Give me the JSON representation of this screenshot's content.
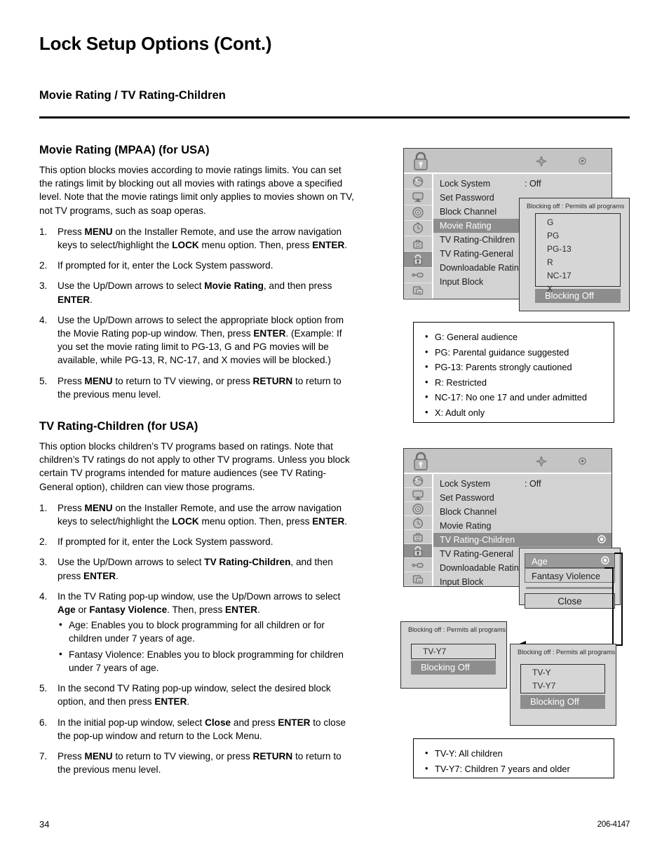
{
  "document": {
    "page_title": "Lock Setup Options (Cont.)",
    "section_title": "Movie Rating / TV Rating-Children",
    "page_number": "34",
    "doc_number": "206-4147"
  },
  "movie_rating": {
    "heading": "Movie Rating (MPAA) (for USA)",
    "intro": "This option blocks movies according to movie ratings limits. You can set the ratings limit by blocking out all movies with ratings above a specified level. Note that the movie ratings limit only applies to movies shown on TV, not TV programs, such as soap operas.",
    "steps": [
      {
        "num": "1.",
        "html": "Press <b>MENU</b> on the Installer Remote, and use the arrow navigation keys to select/highlight the <b>LOCK</b> menu option. Then, press <b>ENTER</b>."
      },
      {
        "num": "2.",
        "html": "If prompted for it, enter the Lock System password."
      },
      {
        "num": "3.",
        "html": "Use the Up/Down arrows to select <b>Movie Rating</b>, and then press <b>ENTER</b>."
      },
      {
        "num": "4.",
        "html": "Use the Up/Down arrows to select the appropriate block option from the Movie Rating pop-up window. Then, press <b>ENTER</b>. (Example: If you set the movie rating limit to PG-13, G and PG movies will be available, while PG-13, R, NC-17, and X movies will be blocked.)"
      },
      {
        "num": "5.",
        "html": "Press <b>MENU</b> to return to TV viewing, or press <b>RETURN</b> to return to the previous menu level."
      }
    ]
  },
  "tv_rating_children": {
    "heading": "TV Rating-Children (for USA)",
    "intro": "This option blocks children’s TV programs based on ratings. Note that children’s TV ratings do not apply to other TV programs. Unless you block certain TV programs intended for mature audiences (see TV Rating-General option), children can view those programs.",
    "steps": [
      {
        "num": "1.",
        "html": "Press <b>MENU</b> on the Installer Remote, and use the arrow navigation keys to select/highlight the <b>LOCK</b> menu option. Then, press <b>ENTER</b>."
      },
      {
        "num": "2.",
        "html": "If prompted for it, enter the Lock System password."
      },
      {
        "num": "3.",
        "html": "Use the Up/Down arrows to select <b>TV Rating-Children</b>, and then press <b>ENTER</b>."
      },
      {
        "num": "4.",
        "html": "In the TV Rating pop-up window, use the Up/Down arrows to select <b>Age</b> or <b>Fantasy Violence</b>. Then, press <b>ENTER</b>.",
        "bullets": [
          "Age: Enables you to block programming for all children or for children under 7 years of age.",
          "Fantasy Violence: Enables you to block programming for children under 7 years of age."
        ]
      },
      {
        "num": "5.",
        "html": "In the second TV Rating pop-up window, select the desired block option, and then press <b>ENTER</b>."
      },
      {
        "num": "6.",
        "html": "In the initial pop-up window, select <b>Close</b> and press <b>ENTER</b> to close the pop-up window and return to the Lock Menu."
      },
      {
        "num": "7.",
        "html": "Press <b>MENU</b> to return to TV viewing, or press <b>RETURN</b> to return to the previous menu level."
      }
    ]
  },
  "osd_menu_1": {
    "rail_icons": [
      "picture-icon",
      "screen-icon",
      "gear-icon",
      "clock-icon",
      "briefcase-icon",
      "lock-icon",
      "plug-icon",
      "setup-icon"
    ],
    "selected_rail_index": 5,
    "header_icons": [
      "lock-icon",
      "navigation-pad-icon",
      "enter-ok-icon"
    ],
    "items": [
      {
        "label": "Lock System",
        "value": ": Off",
        "highlighted": false
      },
      {
        "label": "Set Password",
        "value": "",
        "highlighted": false
      },
      {
        "label": "Block Channel",
        "value": "",
        "highlighted": false
      },
      {
        "label": "Movie Rating",
        "value": "",
        "highlighted": true
      },
      {
        "label": "TV Rating-Children",
        "value": "",
        "highlighted": false
      },
      {
        "label": "TV Rating-General",
        "value": "",
        "highlighted": false
      },
      {
        "label": "Downloadable Rating",
        "value": "",
        "highlighted": false
      },
      {
        "label": "Input Block",
        "value": "",
        "highlighted": false
      }
    ]
  },
  "movie_popup": {
    "caption": "Blocking off : Permits all programs",
    "options": [
      "G",
      "PG",
      "PG-13",
      "R",
      "NC-17",
      "X"
    ],
    "footer": "Blocking Off"
  },
  "mpaa_legend": {
    "items": [
      "G: General audience",
      "PG: Parental guidance suggested",
      "PG-13: Parents strongly cautioned",
      "R: Restricted",
      "NC-17: No one 17 and under admitted",
      "X: Adult only"
    ]
  },
  "osd_menu_2": {
    "rail_icons": [
      "picture-icon",
      "screen-icon",
      "gear-icon",
      "clock-icon",
      "briefcase-icon",
      "lock-icon",
      "plug-icon",
      "setup-icon"
    ],
    "selected_rail_index": 5,
    "header_icons": [
      "lock-icon",
      "navigation-pad-icon",
      "enter-ok-icon"
    ],
    "items": [
      {
        "label": "Lock System",
        "value": ": Off",
        "highlighted": false
      },
      {
        "label": "Set Password",
        "value": "",
        "highlighted": false
      },
      {
        "label": "Block Channel",
        "value": "",
        "highlighted": false
      },
      {
        "label": "Movie Rating",
        "value": "",
        "highlighted": false
      },
      {
        "label": "TV Rating-Children",
        "value": "",
        "highlighted": true,
        "radio": true
      },
      {
        "label": "TV Rating-General",
        "value": "",
        "highlighted": false
      },
      {
        "label": "Downloadable Rating",
        "value": "",
        "highlighted": false
      },
      {
        "label": "Input Block",
        "value": "",
        "highlighted": false
      }
    ]
  },
  "age_popup": {
    "rows": [
      {
        "label": "Age",
        "highlighted": true,
        "radio": true
      },
      {
        "label": "Fantasy Violence",
        "highlighted": false,
        "radio": false
      }
    ],
    "close_label": "Close"
  },
  "fantasy_popup": {
    "caption": "Blocking off : Permits all programs",
    "options": [
      "TV-Y7"
    ],
    "footer": "Blocking Off"
  },
  "age_sub_popup": {
    "caption": "Blocking off : Permits all programs",
    "options": [
      "TV-Y",
      "TV-Y7"
    ],
    "footer": "Blocking Off"
  },
  "tvy_legend": {
    "items": [
      "TV-Y: All children",
      "TV-Y7: Children 7 years and older"
    ]
  }
}
